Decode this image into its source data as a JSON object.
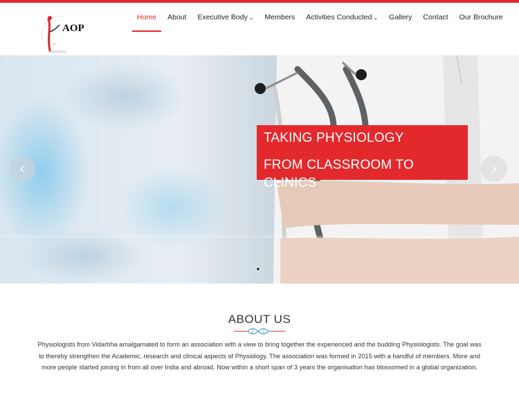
{
  "logo": {
    "arc_text": "ACADEMY OF PHYSIOLOGISTS",
    "abbr": "AOP"
  },
  "nav": {
    "home": "Home",
    "about": "About",
    "executive": "Executive Body",
    "members": "Members",
    "activities": "Activities Conducted",
    "gallery": "Gallery",
    "contact": "Contact",
    "brochure": "Our Brochure"
  },
  "hero": {
    "caption_line1": "TAKING PHYSIOLOGY",
    "caption_line2": "FROM CLASSROOM TO CLINICS",
    "prev_glyph": "‹",
    "next_glyph": "›"
  },
  "about": {
    "title": "ABOUT US",
    "text": "Physiologists from Vidarbha amalgamated to form an association with a view to bring together the experienced and the budding Physiologists. The goal was to thereby strengthen the Academic, research and clinical aspects of Physiology. The association was formed in 2015 with a handful of members. More and more people started joining in from all over India and abroad. Now within a short span of 3 years the organisation has blossomed in a global organization."
  },
  "colors": {
    "accent": "#e1262b"
  }
}
